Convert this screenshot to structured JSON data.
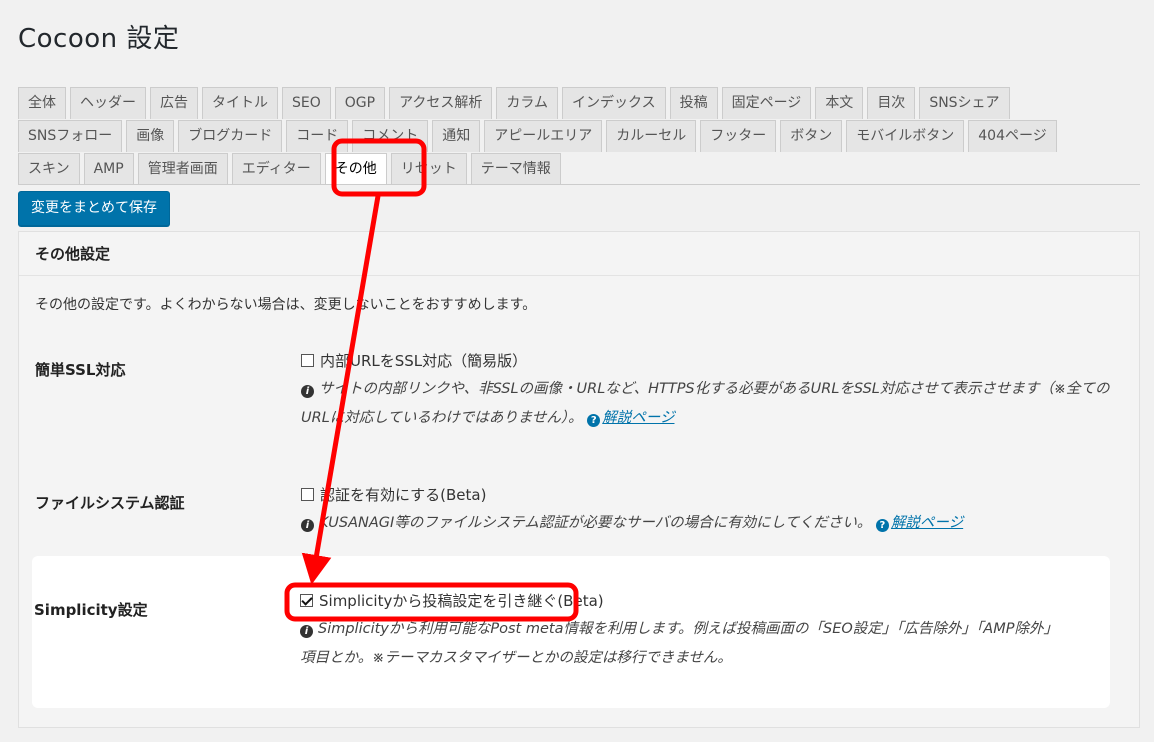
{
  "title": "Cocoon 設定",
  "tabs": {
    "row1": [
      "全体",
      "ヘッダー",
      "広告",
      "タイトル",
      "SEO",
      "OGP",
      "アクセス解析",
      "カラム",
      "インデックス",
      "投稿",
      "固定ページ",
      "本文",
      "目次",
      "SNSシェア"
    ],
    "row2": [
      "SNSフォロー",
      "画像",
      "ブログカード",
      "コード",
      "コメント",
      "通知",
      "アピールエリア",
      "カルーセル",
      "フッター",
      "ボタン",
      "モバイルボタン",
      "404ページ"
    ],
    "row3": [
      "スキン",
      "AMP",
      "管理者画面",
      "エディター",
      "その他",
      "リセット",
      "テーマ情報"
    ],
    "active": "その他"
  },
  "save_button": "変更をまとめて保存",
  "panel": {
    "title": "その他設定",
    "description": "その他の設定です。よくわからない場合は、変更しないことをおすすめします。",
    "ssl": {
      "label": "簡単SSL対応",
      "checkbox": "内部URLをSSL対応（簡易版）",
      "checked": false,
      "note": "サイトの内部リンクや、非SSLの画像・URLなど、HTTPS化する必要があるURLをSSL対応させて表示させます（※全てのURLに対応しているわけではありません）。",
      "link": "解説ページ"
    },
    "filesystem": {
      "label": "ファイルシステム認証",
      "checkbox": "認証を有効にする(Beta)",
      "checked": false,
      "note": "KUSANAGI等のファイルシステム認証が必要なサーバの場合に有効にしてください。",
      "link": "解説ページ"
    },
    "simplicity": {
      "label": "Simplicity設定",
      "checkbox": "Simplicityから投稿設定を引き継ぐ(Beta)",
      "checked": true,
      "note_line1": "Simplicityから利用可能なPost meta情報を利用します。例えば投稿画面の「SEO設定」「広告除外」「AMP除外」",
      "note_line2": "項目とか。※テーマカスタマイザーとかの設定は移行できません。"
    }
  },
  "colors": {
    "annotation_red": "#ff0000",
    "primary_button": "#0073aa"
  }
}
